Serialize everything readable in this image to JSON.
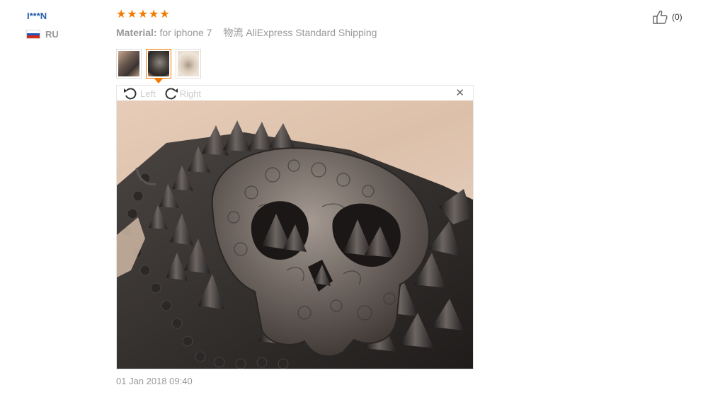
{
  "reviewer": {
    "name": "I***N",
    "country_code": "RU",
    "flag_colors": [
      "#ffffff",
      "#1c56b8",
      "#d52b1e"
    ]
  },
  "rating": {
    "stars": 5,
    "star_glyph": "★",
    "color": "#f27a00"
  },
  "review_info": {
    "attribute_key": "Material:",
    "attribute_value": "for iphone 7",
    "shipping_label": "物流",
    "shipping_value": "AliExpress Standard Shipping"
  },
  "helpful": {
    "icon": "thumbs-up-icon",
    "count": "(0)"
  },
  "thumbnails": [
    {
      "name": "thumbnail-1",
      "active": false
    },
    {
      "name": "thumbnail-2",
      "active": true
    },
    {
      "name": "thumbnail-3",
      "active": false
    }
  ],
  "viewer": {
    "rotate_left_label": "Left",
    "rotate_right_label": "Right",
    "close_glyph": "✕"
  },
  "date": "01 Jan 2018 09:40",
  "colors": {
    "accent": "#f27a00",
    "link": "#2962ab",
    "muted": "#999999"
  }
}
